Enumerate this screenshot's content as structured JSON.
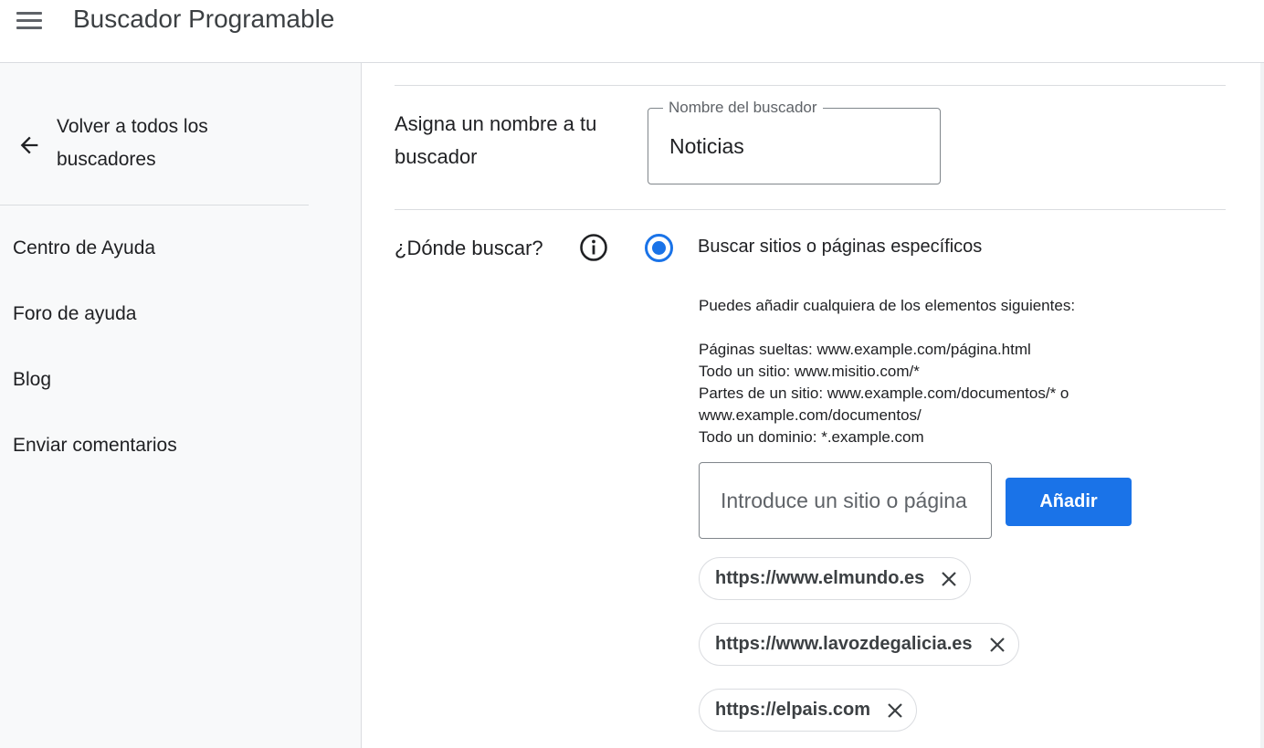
{
  "app": {
    "title": "Buscador Programable"
  },
  "sidebar": {
    "back_label": "Volver a todos los buscadores",
    "items": [
      {
        "label": "Centro de Ayuda"
      },
      {
        "label": "Foro de ayuda"
      },
      {
        "label": "Blog"
      },
      {
        "label": "Enviar comentarios"
      }
    ]
  },
  "main": {
    "name_section": {
      "label": "Asigna un nombre a tu buscador",
      "field_label": "Nombre del buscador",
      "field_value": "Noticias"
    },
    "where_section": {
      "label": "¿Dónde buscar?",
      "option_label": "Buscar sitios o páginas específicos",
      "option_selected": true,
      "help_intro": "Puedes añadir cualquiera de los elementos siguientes:",
      "help_lines": [
        "Páginas sueltas: www.example.com/página.html",
        "Todo un sitio: www.misitio.com/*",
        "Partes de un sitio: www.example.com/documentos/* o www.example.com/documentos/",
        "Todo un dominio: *.example.com"
      ],
      "site_input_placeholder": "Introduce un sitio o página",
      "site_input_value": "",
      "add_button_label": "Añadir",
      "sites": [
        {
          "label": "https://www.elmundo.es"
        },
        {
          "label": "https://www.lavozdegalicia.es"
        },
        {
          "label": "https://elpais.com"
        }
      ]
    }
  },
  "colors": {
    "accent": "#1a73e8",
    "sidebar_bg": "#f8f9fa",
    "divider": "#dadce0"
  },
  "icons": {
    "menu": "menu-icon",
    "back": "arrow-left-icon",
    "info": "info-icon",
    "remove": "close-icon"
  }
}
